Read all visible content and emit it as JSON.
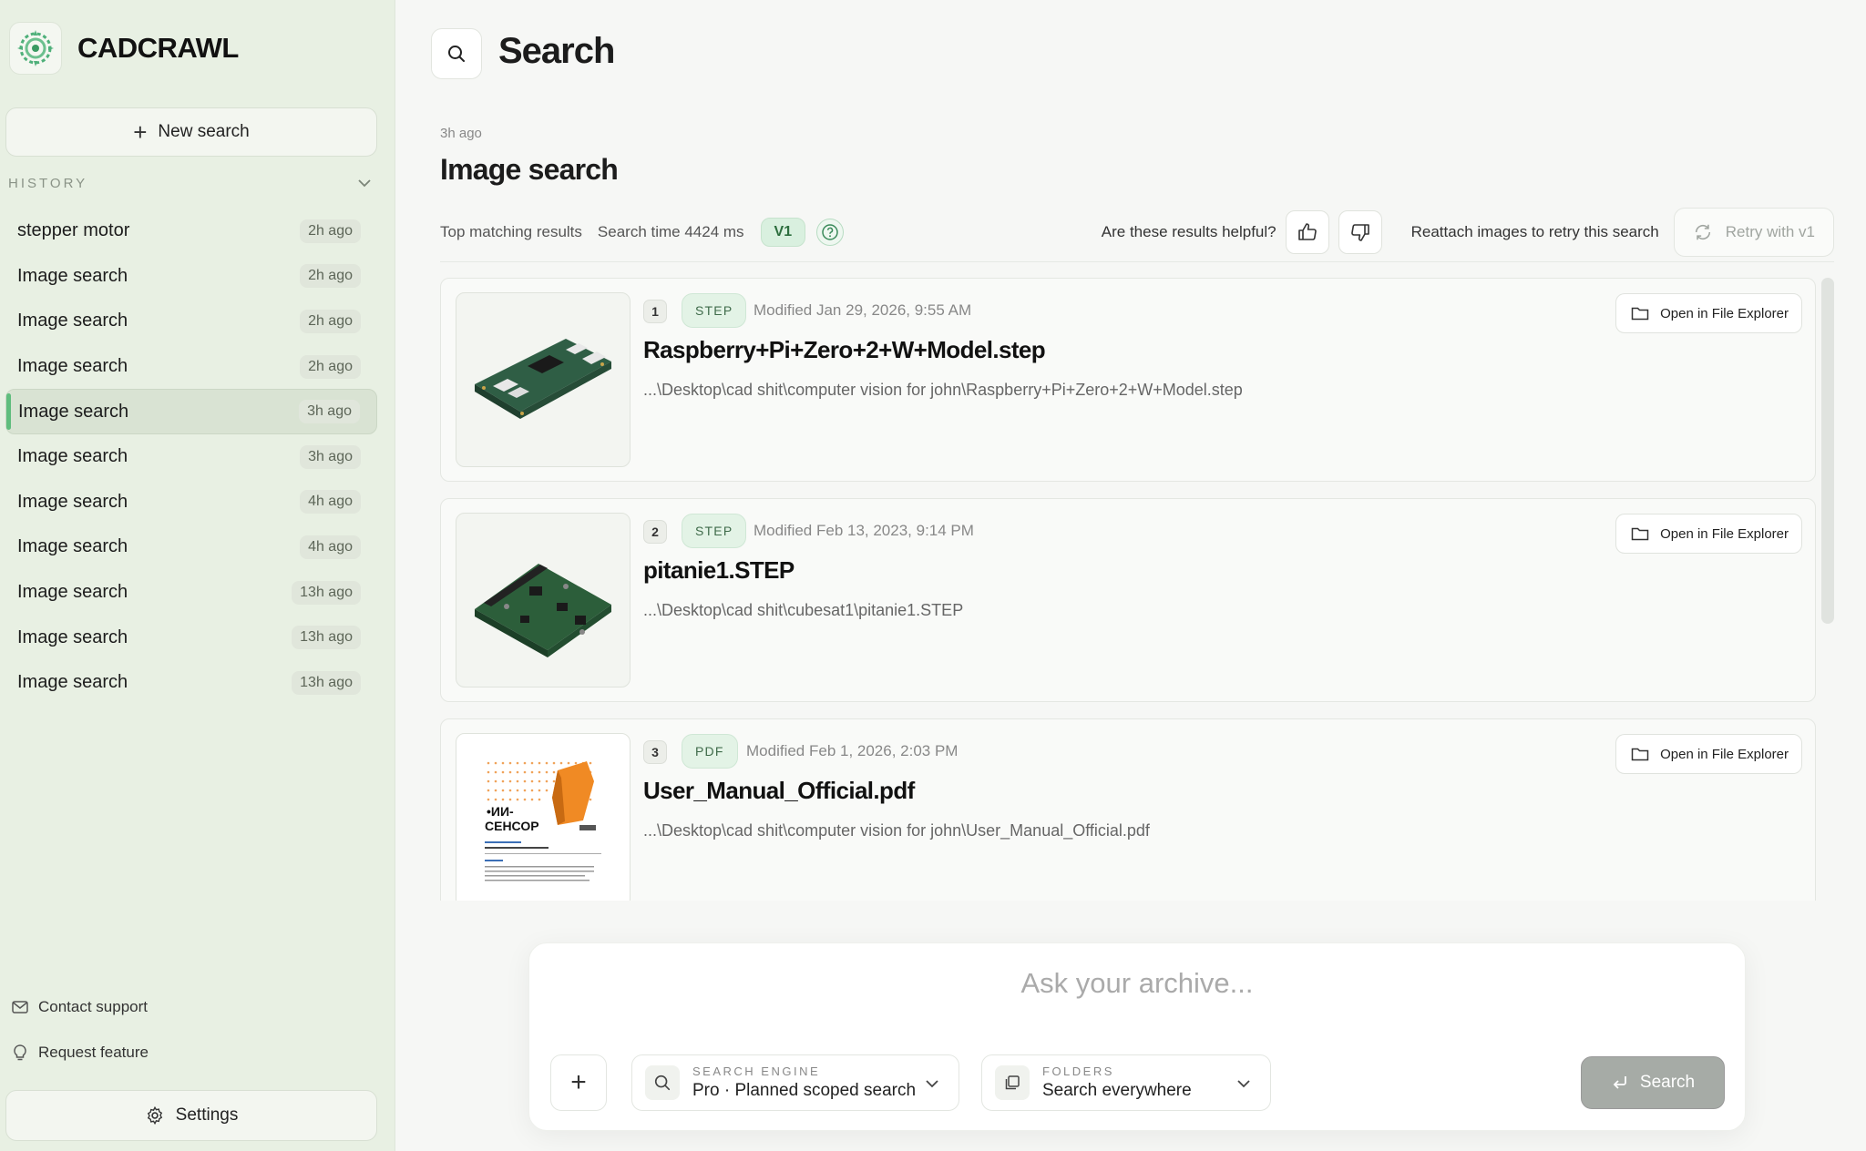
{
  "app": {
    "name": "CADCRAWL"
  },
  "sidebar": {
    "new_search_label": "New search",
    "history_title": "HISTORY",
    "history": [
      {
        "label": "stepper motor",
        "time": "2h ago"
      },
      {
        "label": "Image search",
        "time": "2h ago"
      },
      {
        "label": "Image search",
        "time": "2h ago"
      },
      {
        "label": "Image search",
        "time": "2h ago"
      },
      {
        "label": "Image search",
        "time": "3h ago"
      },
      {
        "label": "Image search",
        "time": "3h ago"
      },
      {
        "label": "Image search",
        "time": "4h ago"
      },
      {
        "label": "Image search",
        "time": "4h ago"
      },
      {
        "label": "Image search",
        "time": "13h ago"
      },
      {
        "label": "Image search",
        "time": "13h ago"
      },
      {
        "label": "Image search",
        "time": "13h ago"
      }
    ],
    "contact_support": "Contact support",
    "request_feature": "Request feature",
    "settings": "Settings"
  },
  "header": {
    "title": "Search"
  },
  "search": {
    "timestamp": "3h ago",
    "title": "Image search",
    "top_matching": "Top matching results",
    "search_time": "Search time 4424 ms",
    "version_badge": "V1",
    "helpful_question": "Are these results helpful?",
    "reattach_text": "Reattach images to retry this search",
    "retry_label": "Retry with v1"
  },
  "results": [
    {
      "rank": "1",
      "type": "STEP",
      "modified": "Modified Jan 29, 2026, 9:55 AM",
      "name": "Raspberry+Pi+Zero+2+W+Model.step",
      "path": "...\\Desktop\\cad shit\\computer vision for john\\Raspberry+Pi+Zero+2+W+Model.step",
      "open_label": "Open in File Explorer"
    },
    {
      "rank": "2",
      "type": "STEP",
      "modified": "Modified Feb 13, 2023, 9:14 PM",
      "name": "pitanie1.STEP",
      "path": "...\\Desktop\\cad shit\\cubesat1\\pitanie1.STEP",
      "open_label": "Open in File Explorer"
    },
    {
      "rank": "3",
      "type": "PDF",
      "modified": "Modified Feb 1, 2026, 2:03 PM",
      "name": "User_Manual_Official.pdf",
      "path": "...\\Desktop\\cad shit\\computer vision for john\\User_Manual_Official.pdf",
      "open_label": "Open in File Explorer",
      "thumb_text": "ИИ-СЕНСОР"
    }
  ],
  "composer": {
    "placeholder": "Ask your archive...",
    "engine_label": "SEARCH ENGINE",
    "engine_value": "Pro · Planned scoped search",
    "folders_label": "FOLDERS",
    "folders_value": "Search everywhere",
    "search_button": "Search"
  },
  "colors": {
    "accent": "#5fbd7d",
    "sidebar_bg": "#e8f0e3",
    "badge_bg": "#d9f0df"
  },
  "icons": [
    "logo-icon",
    "plus-icon",
    "chevron-down-icon",
    "search-icon",
    "help-icon",
    "thumbs-up-icon",
    "thumbs-down-icon",
    "refresh-icon",
    "folder-icon",
    "mail-icon",
    "lightbulb-icon",
    "gear-icon",
    "enter-icon"
  ]
}
